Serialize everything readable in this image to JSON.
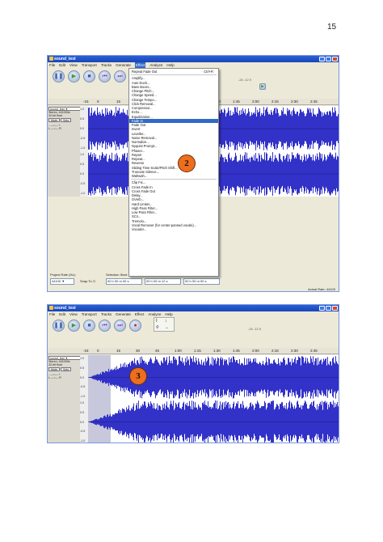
{
  "page_number": "15",
  "window_title": "sound_test",
  "menu_bar": [
    "File",
    "Edit",
    "View",
    "Transport",
    "Tracks",
    "Generate",
    "Effect",
    "Analyze",
    "Help"
  ],
  "menu_bar_active_index": 6,
  "ruler_labels": [
    "-15",
    "0",
    "15",
    "30",
    "45",
    "1:00",
    "1:15",
    "1:30",
    "1:45",
    "2:00",
    "2:15",
    "2:30",
    "2:45"
  ],
  "track": {
    "name": "sound_test",
    "info_line1": "Stereo, 44100Hz",
    "info_line2": "32-bit float",
    "mute": "Mute",
    "solo": "Solo",
    "gain_minus": "-",
    "gain_plus": "+",
    "pan_l": "L",
    "pan_r": "R"
  },
  "amplitude_scale": [
    "1.0",
    "0.5",
    "0.0",
    "-0.5",
    "-1.0"
  ],
  "meter_labels": [
    "-24",
    "-12",
    "0"
  ],
  "effect_menu": {
    "top_item": "Repeat Fade Out",
    "top_shortcut": "Ctrl+R",
    "groups": [
      [
        "Amplify...",
        "Auto Duck...",
        "Bass Boost...",
        "Change Pitch...",
        "Change Speed...",
        "Change Tempo...",
        "Click Removal...",
        "Compressor...",
        "Echo...",
        "Equalization...",
        "Fade In",
        "Fade Out",
        "Invert",
        "Leveller...",
        "Noise Removal...",
        "Normalize...",
        "Nyquist Prompt...",
        "Phaser...",
        "Repair",
        "Repeat...",
        "Reverse",
        "Sliding Time Scale/Pitch Shift...",
        "Truncate Silence...",
        "Wahwah..."
      ],
      [
        "Clip Fix...",
        "Cross Fade In",
        "Cross Fade Out",
        "Delay...",
        "GVerb...",
        "Hard Limiter...",
        "High Pass Filter...",
        "Low Pass Filter...",
        "SC4...",
        "Tremolo...",
        "Vocal Remover (for center-panned vocals)...",
        "Vocoder..."
      ]
    ],
    "selected": "Fade In"
  },
  "bottom": {
    "project_rate_label": "Project Rate (Hz):",
    "project_rate_value": "44100",
    "snap_to": "Snap To",
    "selection_start_label": "Selection Start:",
    "end_label": "End",
    "length_label": "Length",
    "audio_position_label": "Audio Position:",
    "time1": "00 h 00 m 00 s",
    "time2": "00 h 00 m 12 s",
    "time3": "00 h 00 m 00 s",
    "actual_rate": "Actual Rate: 44100"
  },
  "badges": [
    "2",
    "3"
  ],
  "colors": {
    "waveform": "#3232c8",
    "selection": "#c8c8dc",
    "badge": "#ec6e1e",
    "menu_highlight": "#316ac5"
  },
  "faded_in_fraction": 0.2
}
